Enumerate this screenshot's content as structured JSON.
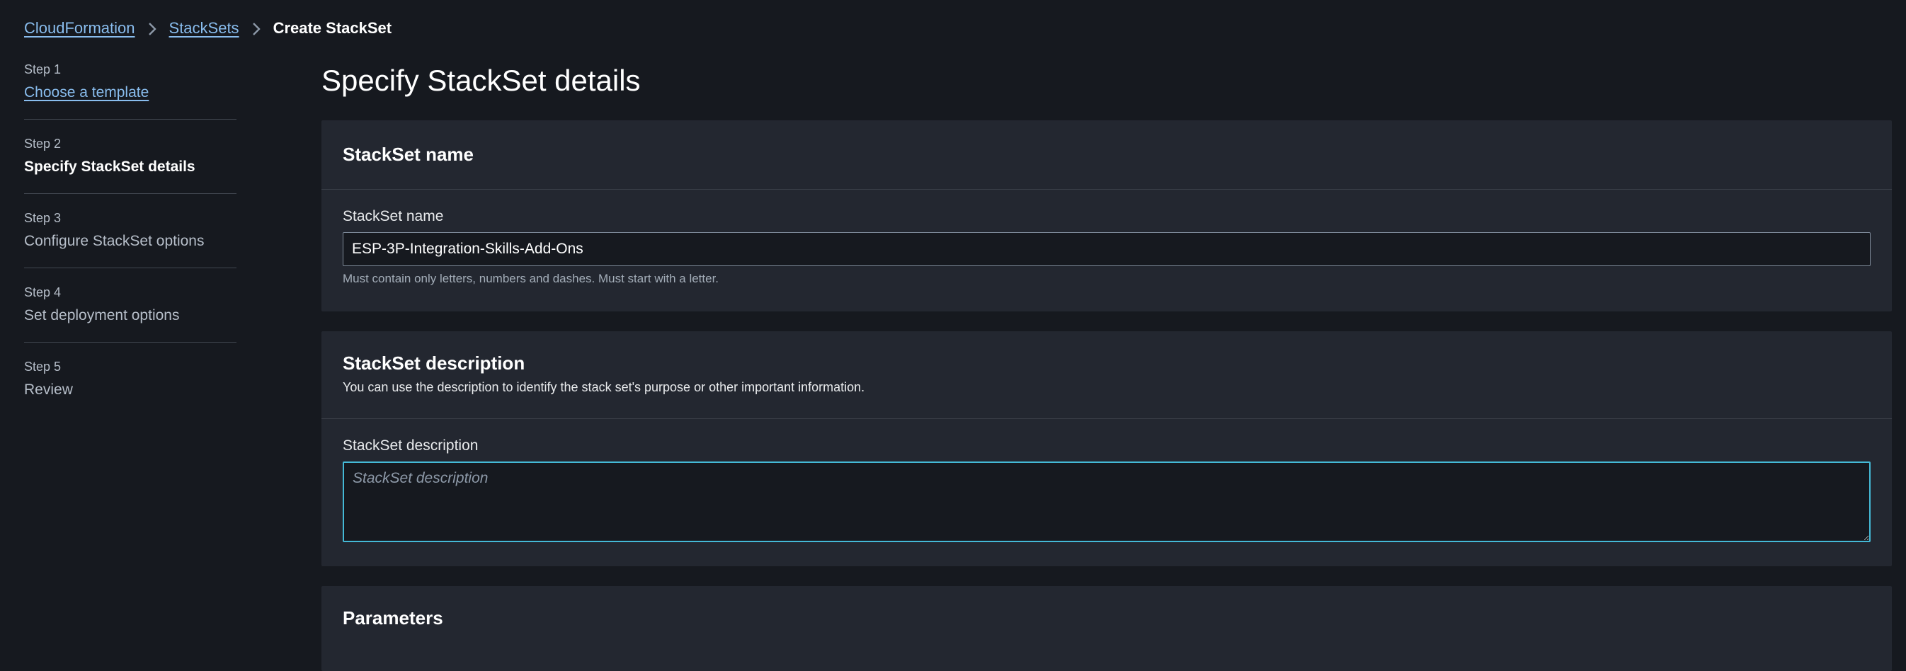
{
  "breadcrumb": {
    "items": [
      {
        "label": "CloudFormation"
      },
      {
        "label": "StackSets"
      }
    ],
    "current": "Create StackSet"
  },
  "steps": [
    {
      "num": "Step 1",
      "title": "Choose a template",
      "state": "link"
    },
    {
      "num": "Step 2",
      "title": "Specify StackSet details",
      "state": "active"
    },
    {
      "num": "Step 3",
      "title": "Configure StackSet options",
      "state": "disabled"
    },
    {
      "num": "Step 4",
      "title": "Set deployment options",
      "state": "disabled"
    },
    {
      "num": "Step 5",
      "title": "Review",
      "state": "disabled"
    }
  ],
  "page": {
    "title": "Specify StackSet details"
  },
  "name_panel": {
    "header": "StackSet name",
    "field_label": "StackSet name",
    "value": "ESP-3P-Integration-Skills-Add-Ons",
    "constraint": "Must contain only letters, numbers and dashes. Must start with a letter."
  },
  "description_panel": {
    "header": "StackSet description",
    "description": "You can use the description to identify the stack set's purpose or other important information.",
    "field_label": "StackSet description",
    "placeholder": "StackSet description"
  },
  "parameters_panel": {
    "header": "Parameters"
  },
  "colors": {
    "background": "#16191f",
    "panel": "#232730",
    "link": "#89bdee",
    "focus": "#44b9d6"
  },
  "icons": {
    "separator": "chevron-right-icon"
  }
}
